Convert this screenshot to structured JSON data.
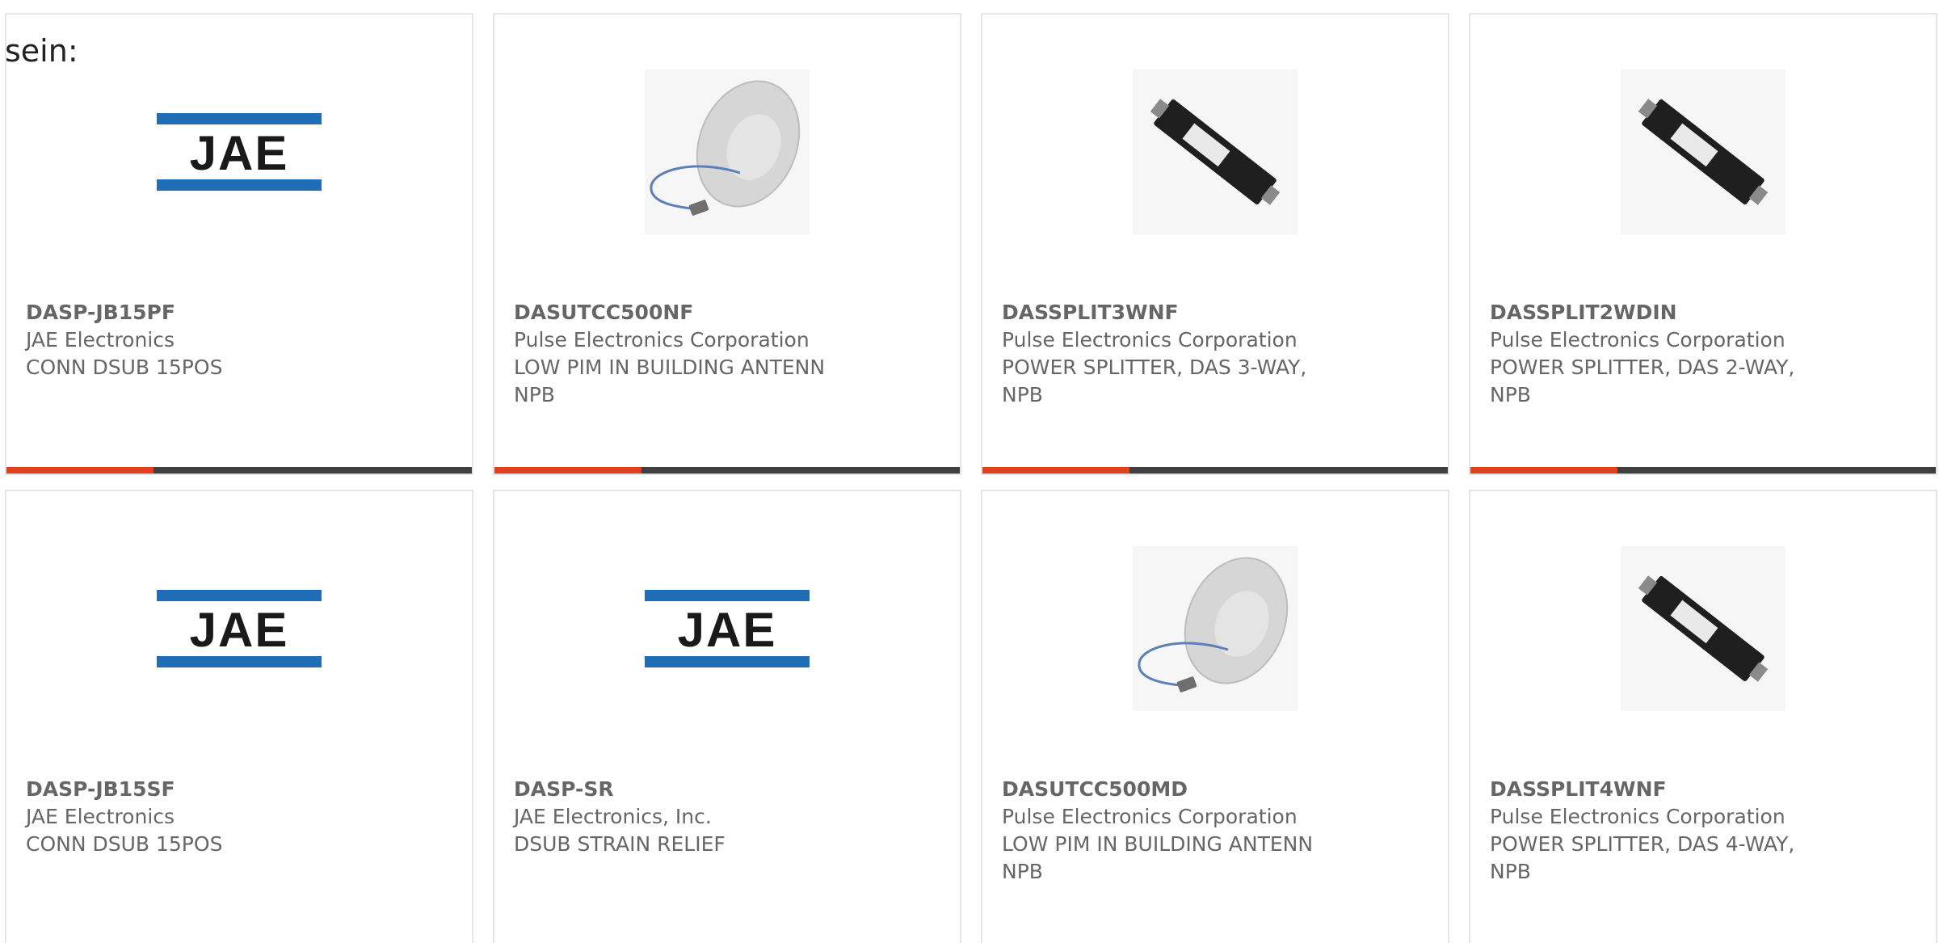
{
  "intro_text": "sein:",
  "colors": {
    "accent": "#e2401c",
    "bar_dark": "#3f3f3f",
    "jae_blue": "#1f6eb5",
    "text": "#666666",
    "card_border": "#e5e5e5"
  },
  "products": [
    {
      "part_number": "DASP-JB15PF",
      "manufacturer": "JAE Electronics",
      "description": "CONN DSUB 15POS",
      "image": "jae-logo",
      "logo_text": "JAE"
    },
    {
      "part_number": "DASUTCC500NF",
      "manufacturer": "Pulse Electronics Corporation",
      "description": "LOW PIM IN BUILDING ANTENN NPB",
      "image": "antenna-photo"
    },
    {
      "part_number": "DASSPLIT3WNF",
      "manufacturer": "Pulse Electronics Corporation",
      "description": "POWER SPLITTER, DAS 3-WAY, NPB",
      "image": "splitter-photo"
    },
    {
      "part_number": "DASSPLIT2WDIN",
      "manufacturer": "Pulse Electronics Corporation",
      "description": "POWER SPLITTER, DAS 2-WAY, NPB",
      "image": "splitter-photo"
    },
    {
      "part_number": "DASP-JB15SF",
      "manufacturer": "JAE Electronics",
      "description": "CONN DSUB 15POS",
      "image": "jae-logo",
      "logo_text": "JAE"
    },
    {
      "part_number": "DASP-SR",
      "manufacturer": "JAE Electronics, Inc.",
      "description": "DSUB STRAIN RELIEF",
      "image": "jae-logo",
      "logo_text": "JAE"
    },
    {
      "part_number": "DASUTCC500MD",
      "manufacturer": "Pulse Electronics Corporation",
      "description": "LOW PIM IN BUILDING ANTENN NPB",
      "image": "antenna-photo"
    },
    {
      "part_number": "DASSPLIT4WNF",
      "manufacturer": "Pulse Electronics Corporation",
      "description": "POWER SPLITTER, DAS 4-WAY, NPB",
      "image": "splitter-photo"
    }
  ]
}
